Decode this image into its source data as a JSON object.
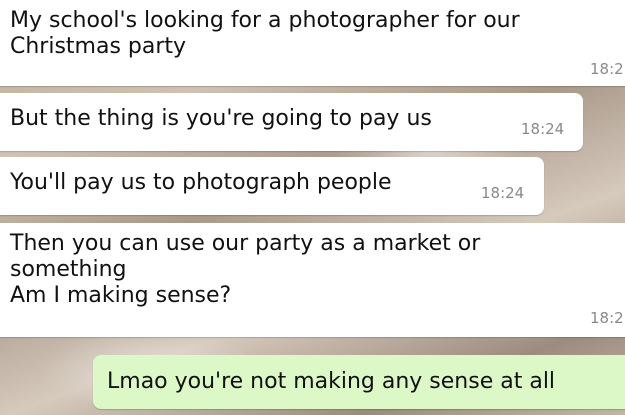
{
  "messages": [
    {
      "direction": "incoming",
      "text": "My school's looking for a photographer for our\nChristmas party",
      "time": "18:2"
    },
    {
      "direction": "incoming",
      "text": "But the thing is you're going to pay us",
      "time": "18:24"
    },
    {
      "direction": "incoming",
      "text": "You'll pay us to photograph people",
      "time": "18:24"
    },
    {
      "direction": "incoming",
      "text": "Then you can use our party as a market or\nsomething\nAm I making sense?",
      "time": "18:2"
    },
    {
      "direction": "outgoing",
      "text": "Lmao you're not making any sense at all"
    }
  ],
  "colors": {
    "incoming_bubble": "#ffffff",
    "outgoing_bubble": "#dcf8c6",
    "timestamp": "#8a8a8a"
  }
}
